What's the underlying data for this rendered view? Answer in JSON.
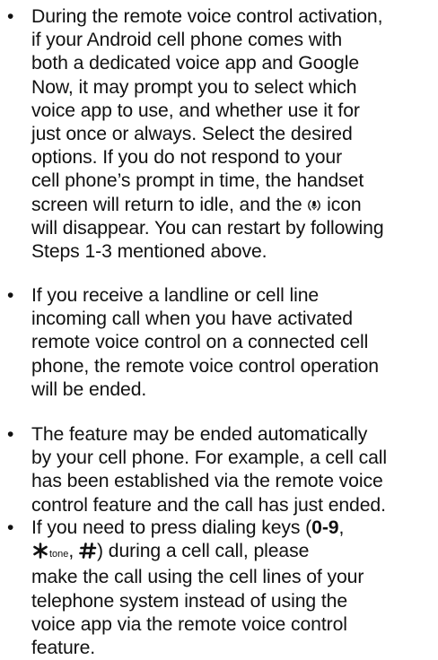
{
  "bullet_char": "•",
  "items": [
    {
      "lines": [
        "During the remote voice control activation,",
        "if your Android cell phone comes with",
        "both a dedicated voice app and Google",
        "Now, it may prompt you to select which",
        "voice app to use, and whether use it for",
        "just once or always. Select the desired",
        "options. If you do not respond to your",
        "cell phone’s prompt in time, the handset",
        "screen will return to idle, and the",
        "icon",
        "will disappear. You can restart by following",
        "Steps 1-3 mentioned above."
      ]
    },
    {
      "lines": [
        "If you receive a landline or cell line",
        "incoming call when you have activated",
        "remote voice control on a connected cell",
        "phone, the remote voice control operation",
        "will be ended."
      ]
    },
    {
      "lines": [
        "The feature may be ended automatically",
        "by your cell phone. For example, a cell call",
        "has been established via the remote voice",
        "control feature and the call has just ended."
      ]
    },
    {
      "lines": [
        "If you need to press dialing keys (",
        "0-9",
        ",",
        "tone",
        ",",
        ") during a cell call, please",
        "make the call using the cell lines of your",
        "telephone system instead of using the",
        "voice app via the remote voice control",
        "feature."
      ]
    }
  ],
  "icons": {
    "voice_icon": "remote-voice-control-icon",
    "star_key_icon": "star-key-icon",
    "pound_key_icon": "pound-key-icon"
  }
}
